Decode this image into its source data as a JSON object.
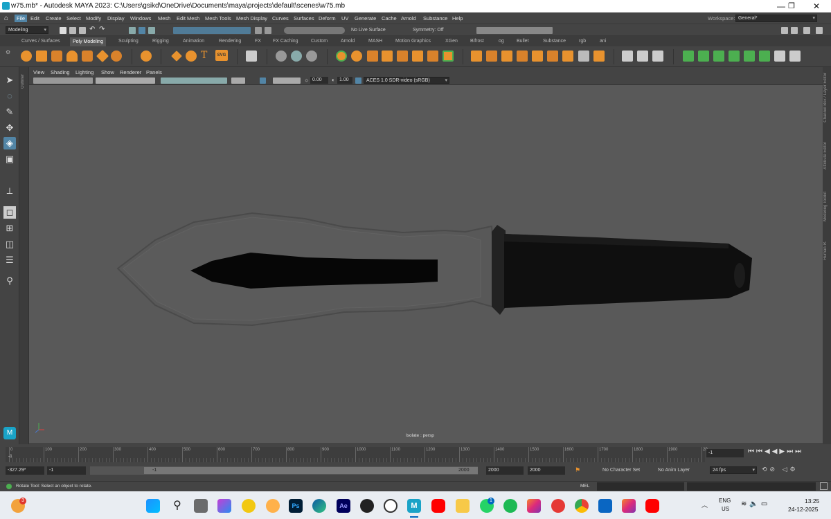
{
  "window": {
    "title": "w75.mb* - Autodesk MAYA 2023: C:\\Users\\gsikd\\OneDrive\\Documents\\maya\\projects\\default\\scenes\\w75.mb",
    "minimize": "—",
    "maximize": "❐",
    "close": "✕"
  },
  "menubar": {
    "items": [
      "File",
      "Edit",
      "Create",
      "Select",
      "Modify",
      "Display",
      "Windows",
      "Mesh",
      "Edit Mesh",
      "Mesh Tools",
      "Mesh Display",
      "Curves",
      "Surfaces",
      "Deform",
      "UV",
      "Generate",
      "Cache",
      "Arnold",
      "Substance",
      "Help"
    ],
    "workspace_label": "Workspace:",
    "workspace_value": "General*"
  },
  "statusline": {
    "mode": "Modeling",
    "live_surface": "No Live Surface",
    "symmetry": "Symmetry: Off"
  },
  "shelf": {
    "tabs": [
      "Curves / Surfaces",
      "Poly Modeling",
      "Sculpting",
      "Rigging",
      "Animation",
      "Rendering",
      "FX",
      "FX Caching",
      "Custom",
      "Arnold",
      "MASH",
      "Motion Graphics",
      "XGen",
      "Bifrost",
      "og",
      "Bullet",
      "Substance",
      "rgb",
      "ani"
    ],
    "active_tab": "Poly Modeling",
    "text_tool": "T",
    "svg_tool": "SVG"
  },
  "viewport": {
    "menu": [
      "View",
      "Shading",
      "Lighting",
      "Show",
      "Renderer",
      "Panels"
    ],
    "exposure": "0.00",
    "gamma": "1.00",
    "colorspace": "ACES 1.0 SDR-video (sRGB)",
    "camera_label": "Isolate : persp"
  },
  "side_panels": [
    "Channel Box / Layer Editor",
    "Attribute Editor",
    "Modeling Toolkit",
    "Human IK"
  ],
  "outliner_label": "Outliner",
  "timeslider": {
    "ticks": [
      "0",
      "100",
      "200",
      "300",
      "400",
      "500",
      "600",
      "700",
      "800",
      "900",
      "1000",
      "1100",
      "1200",
      "1300",
      "1400",
      "1500",
      "1600",
      "1700",
      "1800",
      "1900",
      "20"
    ],
    "current_frame": "-1",
    "current_marker": "-1"
  },
  "rangeslider": {
    "time_value": "-327.29*",
    "start": "-1",
    "range_start": "-1",
    "range_end": "2000",
    "end": "2000",
    "playback_end": "2000",
    "character_set": "No Character Set",
    "anim_layer": "No Anim Layer",
    "fps": "24 fps"
  },
  "cmdline": {
    "lang": "MEL"
  },
  "helpline": {
    "text": "Rotate Tool: Select an object to rotate."
  },
  "taskbar": {
    "lang1": "ENG",
    "lang2": "US",
    "time": "13:25",
    "date": "24-12-2025",
    "badge_left": "3",
    "badge_whatsapp": "1",
    "ps_label": "Ps",
    "ae_label": "Ae",
    "maya_label": "M"
  },
  "colors": {
    "viewport_bg": "#595959",
    "ui_bg": "#444444",
    "accent": "#5285a6",
    "shelf_green": "#4caf50",
    "shelf_orange": "#e8922e"
  }
}
